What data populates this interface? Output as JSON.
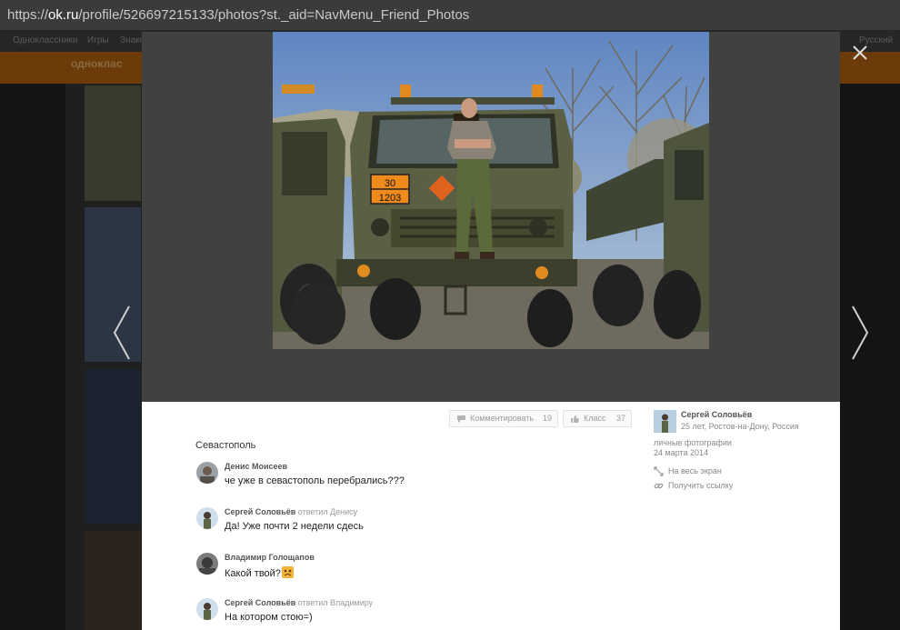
{
  "browser": {
    "url_prefix": "https://",
    "url_host": "ok.ru",
    "url_path": "/profile/526697215133/photos?st._aid=NavMenu_Friend_Photos"
  },
  "site": {
    "topbar_items": [
      "Одноклассники",
      "Игры",
      "Знако"
    ],
    "language": "Русский",
    "logo_text": "одноклас"
  },
  "photo": {
    "plate_top": "30",
    "plate_bottom": "1203"
  },
  "actions": {
    "comment_label": "Комментировать",
    "comment_count": "19",
    "like_label": "Класс",
    "like_count": "37"
  },
  "description": "Севастополь",
  "comments": [
    {
      "author": "Денис Моисеев",
      "reply_to": "",
      "text": "че уже в севастополь перебрались???",
      "emoji": false
    },
    {
      "author": "Сергей Соловьёв",
      "reply_to": "ответил Денису",
      "text": "Да! Уже почти 2  недели сдесь",
      "emoji": false
    },
    {
      "author": "Владимир Голощапов",
      "reply_to": "",
      "text": "Какой твой?",
      "emoji": true
    },
    {
      "author": "Сергей Соловьёв",
      "reply_to": "ответил Владимиру",
      "text": "На котором стою=)",
      "emoji": false
    }
  ],
  "owner": {
    "name": "Сергей Соловьёв",
    "meta": "25 лет, Ростов-на-Дону, Россия",
    "album": "личные фотографии",
    "date": "24 марта 2014",
    "fullscreen_label": "На весь экран",
    "link_label": "Получить ссылку"
  },
  "icons": {
    "close": "close-icon",
    "prev": "chevron-left-icon",
    "next": "chevron-right-icon",
    "comment": "comment-icon",
    "like": "thumbs-up-icon",
    "fullscreen": "expand-icon",
    "link": "link-icon"
  },
  "colors": {
    "overlay": "#414141",
    "site_orange": "#6b3b0a",
    "panel": "#ffffff"
  }
}
